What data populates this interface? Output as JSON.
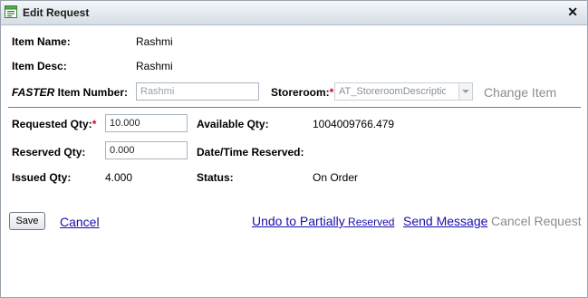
{
  "window": {
    "title": "Edit Request"
  },
  "fields": {
    "item_name_label": "Item Name:",
    "item_name_value": "Rashmi",
    "item_desc_label": "Item Desc:",
    "item_desc_value": "Rashmi",
    "item_number_label_prefix": "FASTER",
    "item_number_label_suffix": " Item Number:",
    "item_number_value": "Rashmi",
    "storeroom_label": "Storeroom:",
    "storeroom_required": "*",
    "storeroom_value": "AT_StoreroomDescription",
    "change_item": "Change Item",
    "requested_qty_label": "Requested Qty:",
    "requested_qty_required": "*",
    "requested_qty_value": "10.000",
    "available_qty_label": "Available Qty:",
    "available_qty_value": "1004009766.479",
    "reserved_qty_label": "Reserved Qty:",
    "reserved_qty_value": "0.000",
    "date_time_reserved_label": "Date/Time Reserved:",
    "date_time_reserved_value": "",
    "issued_qty_label": "Issued Qty:",
    "issued_qty_value": "4.000",
    "status_label": "Status:",
    "status_value": "On Order"
  },
  "actions": {
    "save": "Save",
    "cancel": "Cancel",
    "undo_main": "Undo to Partially",
    "undo_small": " Reserved",
    "send_message": "Send Message",
    "cancel_request": "Cancel Request"
  },
  "icons": {
    "title_icon": "form-icon",
    "close": "close-icon"
  },
  "colors": {
    "link": "#1a0dab",
    "required": "#d0021b",
    "disabled_text": "#8c8c8c"
  }
}
